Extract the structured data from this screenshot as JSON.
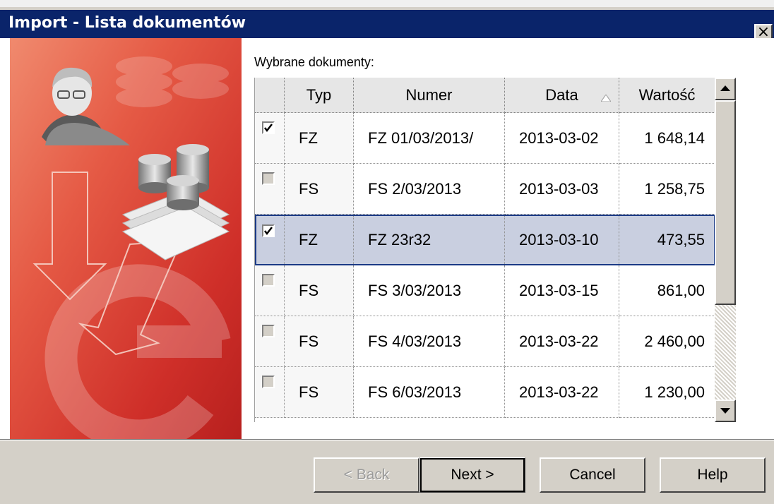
{
  "window": {
    "title": "Import - Lista dokumentów",
    "close_glyph": "×"
  },
  "list": {
    "label": "Wybrane dokumenty:",
    "columns": {
      "typ": "Typ",
      "numer": "Numer",
      "data": "Data",
      "wartosc": "Wartość"
    },
    "sort_column": "Data",
    "rows": [
      {
        "checked": true,
        "typ": "FZ",
        "numer": "FZ 01/03/2013/",
        "data": "2013-03-02",
        "wartosc": "1 648,14",
        "selected": false
      },
      {
        "checked": false,
        "typ": "FS",
        "numer": "FS 2/03/2013",
        "data": "2013-03-03",
        "wartosc": "1 258,75",
        "selected": false
      },
      {
        "checked": true,
        "typ": "FZ",
        "numer": "FZ 23r32",
        "data": "2013-03-10",
        "wartosc": "473,55",
        "selected": true
      },
      {
        "checked": false,
        "typ": "FS",
        "numer": "FS 3/03/2013",
        "data": "2013-03-15",
        "wartosc": "861,00",
        "selected": false
      },
      {
        "checked": false,
        "typ": "FS",
        "numer": "FS 4/03/2013",
        "data": "2013-03-22",
        "wartosc": "2 460,00",
        "selected": false
      },
      {
        "checked": false,
        "typ": "FS",
        "numer": "FS 6/03/2013",
        "data": "2013-03-22",
        "wartosc": "1 230,00",
        "selected": false
      }
    ]
  },
  "buttons": {
    "back": "< Back",
    "next": "Next >",
    "cancel": "Cancel",
    "help": "Help"
  },
  "colors": {
    "titlebar": "#0a246a",
    "selection": "#c9cfe0",
    "side_panel_red": "#d8332b"
  },
  "icons": {
    "side_art": "wizard-illustration",
    "sort": "sort-up-icon",
    "scroll_up": "scroll-up-icon",
    "scroll_down": "scroll-down-icon"
  }
}
